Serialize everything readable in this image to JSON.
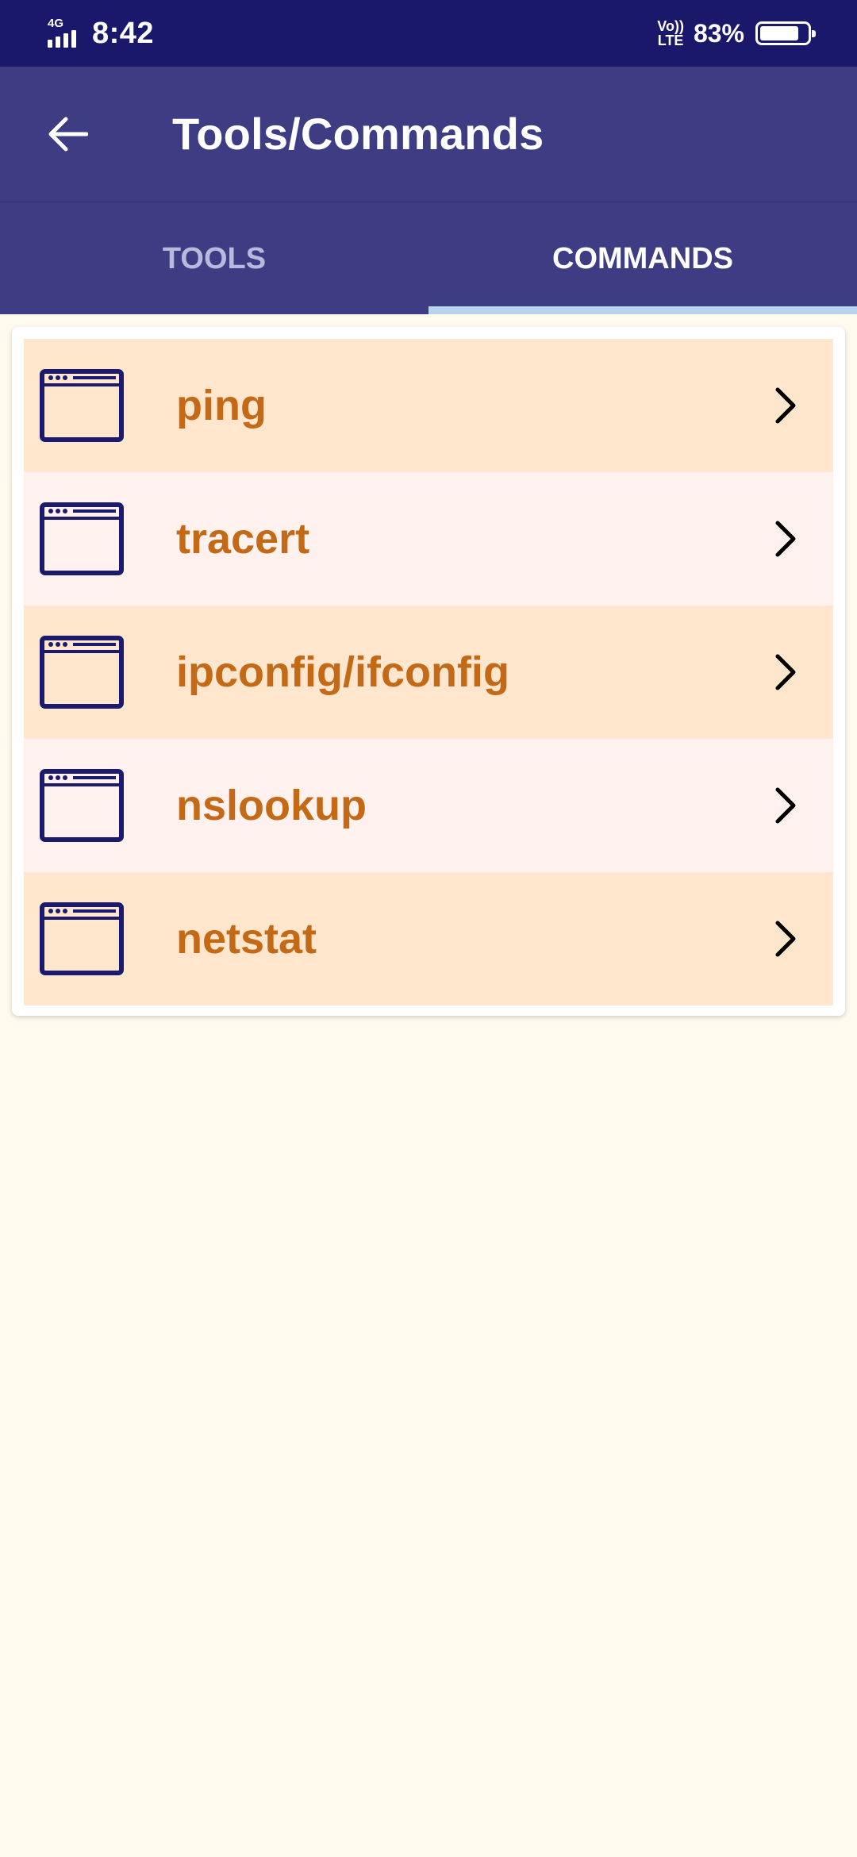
{
  "status_bar": {
    "network": "4G",
    "time": "8:42",
    "volte_top": "Vo))",
    "volte_bottom": "LTE",
    "battery_pct": "83%",
    "battery_level": 0.83
  },
  "app_bar": {
    "back_icon": "arrow-left-icon",
    "title": "Tools/Commands"
  },
  "tabs": [
    {
      "label": "TOOLS",
      "selected": false
    },
    {
      "label": "COMMANDS",
      "selected": true
    }
  ],
  "commands": [
    {
      "label": "ping",
      "icon": "window-icon"
    },
    {
      "label": "tracert",
      "icon": "window-icon"
    },
    {
      "label": "ipconfig/ifconfig",
      "icon": "window-icon"
    },
    {
      "label": "nslookup",
      "icon": "window-icon"
    },
    {
      "label": "netstat",
      "icon": "window-icon"
    }
  ],
  "colors": {
    "status_bar": "#19186B",
    "app_bar": "#3E3D83",
    "tab_indicator": "#B7D3EE",
    "row_odd": "#FFE6CC",
    "row_even": "#FFF2EE",
    "label": "#C46A16",
    "icon": "#1C1A6E",
    "background": "#FFF9EE"
  }
}
